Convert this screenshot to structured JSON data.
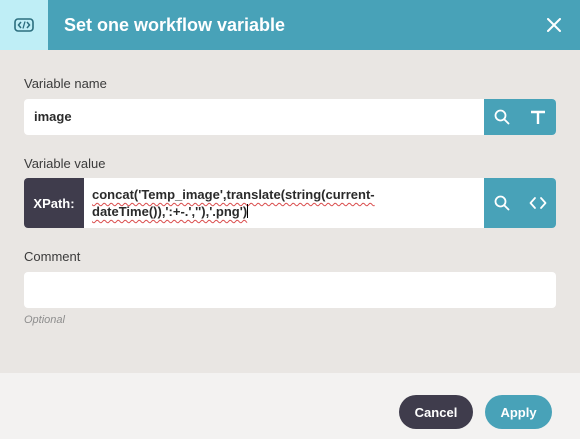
{
  "dialog": {
    "title": "Set one workflow variable",
    "header_icon": "code-tag-icon",
    "close_icon": "close-icon"
  },
  "variable_name": {
    "label": "Variable name",
    "value": "image",
    "search_icon": "search-icon",
    "type_icon": "text-type-icon"
  },
  "variable_value": {
    "label": "Variable value",
    "mode": "XPath:",
    "expression_line1": "concat('Temp_image',translate(string(current-",
    "expression_line2": "dateTime()),':+-.',''),'.png')",
    "search_icon": "search-icon",
    "code_icon": "code-icon"
  },
  "comment": {
    "label": "Comment",
    "value": "",
    "hint": "Optional"
  },
  "footer": {
    "cancel_label": "Cancel",
    "apply_label": "Apply"
  },
  "colors": {
    "accent": "#48a2b8",
    "header_icon_bg": "#bfeef6",
    "dark": "#3f3c4c",
    "background": "#e9e6e3",
    "footer_bg": "#f3f2f1"
  }
}
